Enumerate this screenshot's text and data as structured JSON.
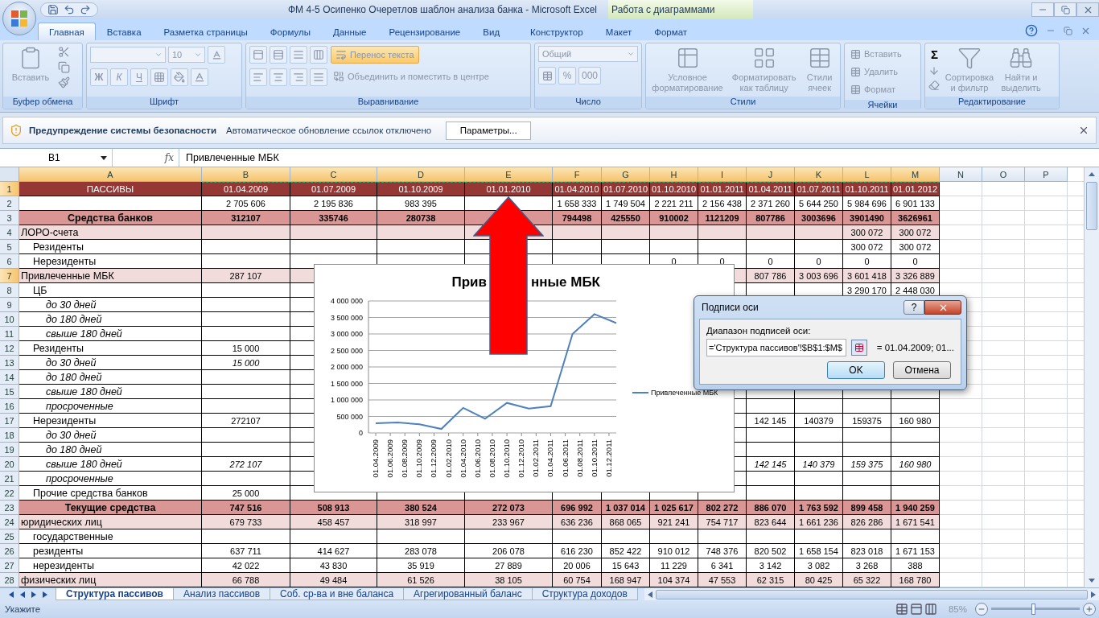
{
  "window": {
    "title": "ФМ 4-5 Осипенко Очеретлов шаблон анализа банка - Microsoft Excel",
    "context_title": "Работа с диаграммами"
  },
  "tabs": [
    {
      "label": "Главная",
      "selected": true
    },
    {
      "label": "Вставка",
      "selected": false
    },
    {
      "label": "Разметка страницы",
      "selected": false
    },
    {
      "label": "Формулы",
      "selected": false
    },
    {
      "label": "Данные",
      "selected": false
    },
    {
      "label": "Рецензирование",
      "selected": false
    },
    {
      "label": "Вид",
      "selected": false
    }
  ],
  "context_tabs": [
    {
      "label": "Конструктор",
      "selected": false
    },
    {
      "label": "Макет",
      "selected": false
    },
    {
      "label": "Формат",
      "selected": false
    }
  ],
  "ribbon": {
    "disabled": true,
    "clipboard": {
      "label": "Буфер обмена",
      "paste": "Вставить"
    },
    "font": {
      "label": "Шрифт",
      "size": "10",
      "bold": "Ж",
      "italic": "К",
      "underline": "Ч"
    },
    "alignment": {
      "label": "Выравнивание",
      "wrap": {
        "label": "Перенос текста",
        "on": true
      },
      "merge": "Объединить и поместить в центре"
    },
    "number": {
      "label": "Число",
      "format": "Общий",
      "percent": "%",
      "thousands": "000"
    },
    "styles": {
      "label": "Стили",
      "buttons": [
        "Условное форматирование",
        "Форматировать как таблицу",
        "Стили ячеек"
      ]
    },
    "cells": {
      "label": "Ячейки",
      "buttons": [
        "Вставить",
        "Удалить",
        "Формат"
      ]
    },
    "editing": {
      "label": "Редактирование",
      "sum": "Σ",
      "buttons": [
        "Сортировка и фильтр",
        "Найти и выделить"
      ]
    }
  },
  "security_bar": {
    "title": "Предупреждение системы безопасности",
    "message": "Автоматическое обновление ссылок отключено",
    "button": "Параметры..."
  },
  "formula_bar": {
    "name_box": "B1",
    "function_label": "fx",
    "formula": "Привлеченные МБК"
  },
  "sheet": {
    "columns": [
      {
        "label": "A",
        "selected": true
      },
      {
        "label": "B",
        "selected": true
      },
      {
        "label": "C",
        "selected": true
      },
      {
        "label": "D",
        "selected": true
      },
      {
        "label": "E",
        "selected": true
      },
      {
        "label": "F",
        "selected": true
      },
      {
        "label": "G",
        "selected": true
      },
      {
        "label": "H",
        "selected": true
      },
      {
        "label": "I",
        "selected": true
      },
      {
        "label": "J",
        "selected": true
      },
      {
        "label": "K",
        "selected": true
      },
      {
        "label": "L",
        "selected": true
      },
      {
        "label": "M",
        "selected": true
      },
      {
        "label": "N",
        "selected": false
      },
      {
        "label": "O",
        "selected": false
      },
      {
        "label": "P",
        "selected": false
      }
    ],
    "rows": [
      {
        "number": "1",
        "selected": true,
        "kind": "header",
        "label": "ПАССИВЫ",
        "values": {
          "B": "01.04.2009",
          "C": "01.07.2009",
          "D": "01.10.2009",
          "E": "01.01.2010",
          "F": "01.04.2010",
          "G": "01.07.2010",
          "H": "01.10.2010",
          "I": "01.01.2011",
          "J": "01.04.2011",
          "K": "01.07.2011",
          "L": "01.10.2011",
          "M": "01.01.2012"
        }
      },
      {
        "number": "2",
        "selected": false,
        "kind": "plain",
        "values": {
          "B": "2 705 606",
          "C": "2 195 836",
          "D": "983 395",
          "F": "1 658 333",
          "G": "1 749 504",
          "H": "2 221 211",
          "I": "2 156 438",
          "J": "2 371 260",
          "K": "5 644 250",
          "L": "5 984 696",
          "M": "6 901 133"
        }
      },
      {
        "number": "3",
        "selected": false,
        "kind": "total",
        "label": "Средства банков",
        "values": {
          "B": "312107",
          "C": "335746",
          "D": "280738",
          "F": "794498",
          "G": "425550",
          "H": "910002",
          "I": "1121209",
          "J": "807786",
          "K": "3003696",
          "L": "3901490",
          "M": "3626961"
        }
      },
      {
        "number": "4",
        "selected": false,
        "kind": "group",
        "label": "ЛОРО-счета",
        "values": {
          "L": "300 072",
          "M": "300 072"
        }
      },
      {
        "number": "5",
        "selected": false,
        "kind": "item",
        "label": "Резиденты",
        "values": {
          "L": "300 072",
          "M": "300 072"
        }
      },
      {
        "number": "6",
        "selected": false,
        "kind": "item",
        "label": "Нерезиденты",
        "values": {
          "H": "0",
          "I": "0",
          "J": "0",
          "K": "0",
          "L": "0",
          "M": "0"
        }
      },
      {
        "number": "7",
        "selected": true,
        "kind": "group",
        "label": "Привлеченные МБК",
        "values": {
          "B": "287 107",
          "J": "807 786",
          "K": "3 003 696",
          "L": "3 601 418",
          "M": "3 326 889"
        }
      },
      {
        "number": "8",
        "selected": false,
        "kind": "item",
        "label": "ЦБ",
        "values": {
          "L": "3 290 170",
          "M": "2 448 030"
        }
      },
      {
        "number": "9",
        "selected": false,
        "kind": "subitem",
        "label": "до 30 дней",
        "values": {}
      },
      {
        "number": "10",
        "selected": false,
        "kind": "subitem",
        "label": "до 180 дней",
        "values": {}
      },
      {
        "number": "11",
        "selected": false,
        "kind": "subitem",
        "label": "свыше 180 дней",
        "values": {}
      },
      {
        "number": "12",
        "selected": false,
        "kind": "item",
        "label": "Резиденты",
        "values": {
          "B": "15 000"
        }
      },
      {
        "number": "13",
        "selected": false,
        "kind": "subitem",
        "label": "до 30 дней",
        "values": {
          "B": "15 000"
        }
      },
      {
        "number": "14",
        "selected": false,
        "kind": "subitem",
        "label": "до 180 дней",
        "values": {}
      },
      {
        "number": "15",
        "selected": false,
        "kind": "subitem",
        "label": "свыше 180 дней",
        "values": {}
      },
      {
        "number": "16",
        "selected": false,
        "kind": "subitem",
        "label": "просроченные",
        "values": {}
      },
      {
        "number": "17",
        "selected": false,
        "kind": "item",
        "label": "Нерезиденты",
        "values": {
          "B": "272107",
          "J": "142 145",
          "K": "140379",
          "L": "159375",
          "M": "160 980"
        }
      },
      {
        "number": "18",
        "selected": false,
        "kind": "subitem",
        "label": "до 30 дней",
        "values": {}
      },
      {
        "number": "19",
        "selected": false,
        "kind": "subitem",
        "label": "до 180 дней",
        "values": {}
      },
      {
        "number": "20",
        "selected": false,
        "kind": "subitem",
        "label": "свыше 180 дней",
        "values": {
          "B": "272 107",
          "J": "142 145",
          "K": "140 379",
          "L": "159 375",
          "M": "160 980"
        }
      },
      {
        "number": "21",
        "selected": false,
        "kind": "subitem",
        "label": "просроченные",
        "values": {}
      },
      {
        "number": "22",
        "selected": false,
        "kind": "item",
        "label": "Прочие средства банков",
        "values": {
          "B": "25 000"
        }
      },
      {
        "number": "23",
        "selected": false,
        "kind": "total",
        "label": "Текущие средства",
        "values": {
          "B": "747 516",
          "C": "508 913",
          "D": "380 524",
          "E": "272 073",
          "F": "696 992",
          "G": "1 037 014",
          "H": "1 025 617",
          "I": "802 272",
          "J": "886 070",
          "K": "1 763 592",
          "L": "899 458",
          "M": "1 940 259"
        }
      },
      {
        "number": "24",
        "selected": false,
        "kind": "group",
        "label": "юридических лиц",
        "values": {
          "B": "679 733",
          "C": "458 457",
          "D": "318 997",
          "E": "233 967",
          "F": "636 236",
          "G": "868 065",
          "H": "921 241",
          "I": "754 717",
          "J": "823 644",
          "K": "1 661 236",
          "L": "826 286",
          "M": "1 671 541"
        }
      },
      {
        "number": "25",
        "selected": false,
        "kind": "item",
        "label": "государственные",
        "values": {}
      },
      {
        "number": "26",
        "selected": false,
        "kind": "item",
        "label": "резиденты",
        "values": {
          "B": "637 711",
          "C": "414 627",
          "D": "283 078",
          "E": "206 078",
          "F": "616 230",
          "G": "852 422",
          "H": "910 012",
          "I": "748 376",
          "J": "820 502",
          "K": "1 658 154",
          "L": "823 018",
          "M": "1 671 153"
        }
      },
      {
        "number": "27",
        "selected": false,
        "kind": "item",
        "label": "нерезиденты",
        "values": {
          "B": "42 022",
          "C": "43 830",
          "D": "35 919",
          "E": "27 889",
          "F": "20 006",
          "G": "15 643",
          "H": "11 229",
          "I": "6 341",
          "J": "3 142",
          "K": "3 082",
          "L": "3 268",
          "M": "388"
        }
      },
      {
        "number": "28",
        "selected": false,
        "kind": "group",
        "label": "физических лиц",
        "values": {
          "B": "66 788",
          "C": "49 484",
          "D": "61 526",
          "E": "38 105",
          "F": "60 754",
          "G": "168 947",
          "H": "104 374",
          "I": "47 553",
          "J": "62 315",
          "K": "80 425",
          "L": "65 322",
          "M": "168 780"
        }
      }
    ]
  },
  "chart": {
    "title_parts": [
      "Прив",
      "нные МБК"
    ],
    "chart_data": {
      "type": "line",
      "categories": [
        "01.04.2009",
        null,
        "01.06.2009",
        null,
        "01.08.2009",
        null,
        "01.10.2009",
        null,
        "01.12.2009",
        null,
        "01.02.2010",
        null,
        "01.04.2010",
        null,
        "01.06.2010",
        null,
        "01.08.2010",
        null,
        "01.10.2010",
        null,
        "01.12.2010",
        null,
        "01.02.2011",
        null,
        "01.04.2011",
        null,
        "01.06.2011",
        null,
        "01.08.2011",
        null,
        "01.10.2011",
        null,
        "01.12.2011",
        null
      ],
      "series": [
        {
          "name": "Привлеченные МБК",
          "color": "#4f81bd",
          "values": [
            290000,
            null,
            null,
            320000,
            null,
            null,
            260000,
            null,
            null,
            120000,
            null,
            null,
            760000,
            null,
            null,
            430000,
            null,
            null,
            910000,
            null,
            null,
            740000,
            null,
            null,
            810000,
            null,
            null,
            3000000,
            null,
            null,
            3600000,
            null,
            null,
            3330000
          ]
        }
      ],
      "ylim": [
        0,
        4000000
      ],
      "grid": true,
      "yticks": [
        {
          "value": 0,
          "label": "0"
        },
        {
          "value": 500000,
          "label": "500 000"
        },
        {
          "value": 1000000,
          "label": "1 000 000"
        },
        {
          "value": 1500000,
          "label": "1 500 000"
        },
        {
          "value": 2000000,
          "label": "2 000 000"
        },
        {
          "value": 2500000,
          "label": "2 500 000"
        },
        {
          "value": 3000000,
          "label": "3 000 000"
        },
        {
          "value": 3500000,
          "label": "3 500 000"
        },
        {
          "value": 4000000,
          "label": "4 000 000"
        }
      ]
    }
  },
  "dialog": {
    "title": "Подписи оси",
    "help": "?",
    "field_label": "Диапазон подписей оси:",
    "value": "='Структура пассивов'!$B$1:$M$",
    "preview": "= 01.04.2009; 01...",
    "buttons": [
      {
        "label": "OK",
        "default": true
      },
      {
        "label": "Отмена",
        "default": false
      }
    ]
  },
  "sheet_tabs": [
    {
      "label": "Структура пассивов",
      "selected": true
    },
    {
      "label": "Анализ пассивов",
      "selected": false
    },
    {
      "label": "Соб. ср-ва и вне баланса",
      "selected": false
    },
    {
      "label": "Агрегированный баланс",
      "selected": false
    },
    {
      "label": "Структура доходов",
      "selected": false
    }
  ],
  "status_bar": {
    "mode": "Укажите",
    "zoom": "85%",
    "zoom_slider": {
      "level": 0.47
    }
  }
}
